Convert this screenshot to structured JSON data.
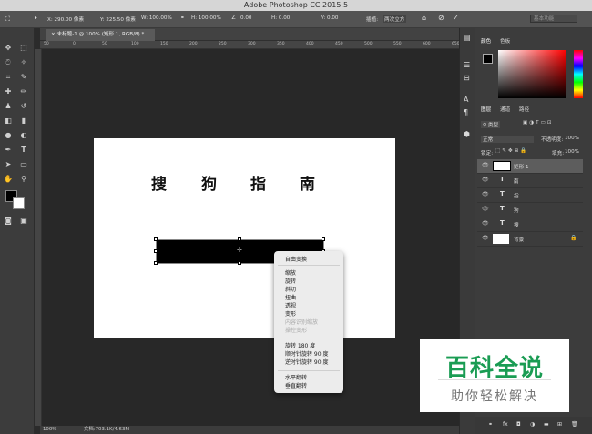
{
  "app": {
    "title": "Adobe Photoshop CC 2015.5"
  },
  "options_bar": {
    "x": "X: 290.00 像素",
    "y": "Y: 225.50 像素",
    "w": "W: 100.00%",
    "h": "H: 100.00%",
    "angle": "0.00",
    "hskew": "H: 0.00",
    "vskew": "V: 0.00",
    "interp_label": "插值:",
    "interp_value": "两次立方",
    "workspace": "基本功能"
  },
  "document": {
    "tab_label": "未标题-1 @ 100% (矩形 1, RGB/8) *"
  },
  "ruler": {
    "marks": [
      "50",
      "0",
      "50",
      "100",
      "150",
      "200",
      "250",
      "300",
      "350",
      "400",
      "450",
      "500",
      "550",
      "600",
      "650"
    ]
  },
  "artboard_text": [
    "搜",
    "狗",
    "指",
    "南"
  ],
  "context_menu": {
    "group1": [
      "自由变换"
    ],
    "group2": [
      "缩放",
      "旋转",
      "斜切",
      "扭曲",
      "透视",
      "变形"
    ],
    "group2_disabled": [
      "内容识别缩放",
      "操控变形"
    ],
    "group3": [
      "旋转 180 度",
      "顺时针旋转 90 度",
      "逆时针旋转 90 度"
    ],
    "group4": [
      "水平翻转",
      "垂直翻转"
    ]
  },
  "status": {
    "zoom": "100%",
    "doc": "文档:703.1K/4.63M"
  },
  "color_panel": {
    "tab1": "颜色",
    "tab2": "色板"
  },
  "layers_panel": {
    "tab1": "图层",
    "tab2": "通道",
    "tab3": "路径",
    "filter": "类型",
    "blend": "正常",
    "opacity_label": "不透明度:",
    "opacity": "100%",
    "lock_label": "锁定:",
    "fill_label": "填充:",
    "fill": "100%",
    "layers": [
      {
        "name": "矩形 1",
        "kind": "shape"
      },
      {
        "name": "南",
        "kind": "text"
      },
      {
        "name": "指",
        "kind": "text"
      },
      {
        "name": "狗",
        "kind": "text"
      },
      {
        "name": "搜",
        "kind": "text"
      },
      {
        "name": "背景",
        "kind": "background"
      }
    ]
  },
  "watermark": {
    "title": "百科全说",
    "subtitle": "助你轻松解决"
  },
  "colors": {
    "fg": "#000000",
    "bg": "#ffffff",
    "watermark_green": "#1a9c53"
  }
}
